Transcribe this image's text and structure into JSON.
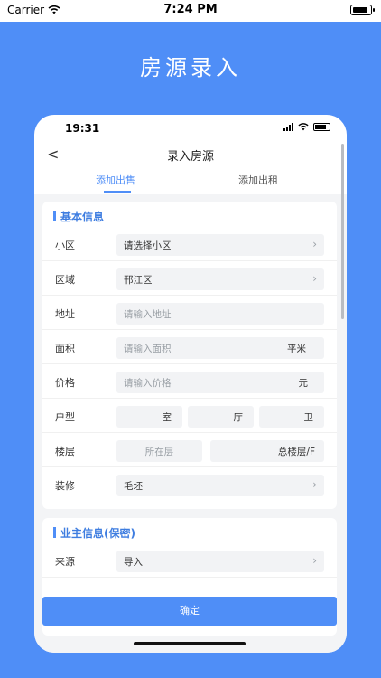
{
  "outer_status": {
    "carrier": "Carrier",
    "time": "7:24 PM"
  },
  "hero_title": "房源录入",
  "inner_status": {
    "time": "19:31"
  },
  "nav": {
    "back": "<",
    "title": "录入房源"
  },
  "tabs": [
    {
      "label": "添加出售",
      "active": true
    },
    {
      "label": "添加出租",
      "active": false
    }
  ],
  "basic_info": {
    "title": "基本信息",
    "community": {
      "label": "小区",
      "value": "请选择小区"
    },
    "district": {
      "label": "区域",
      "value": "邗江区"
    },
    "address": {
      "label": "地址",
      "placeholder": "请输入地址"
    },
    "area": {
      "label": "面积",
      "placeholder": "请输入面积",
      "unit": "平米"
    },
    "price": {
      "label": "价格",
      "placeholder": "请输入价格",
      "unit": "元"
    },
    "layout": {
      "label": "户型",
      "room": "室",
      "hall": "厅",
      "bath": "卫"
    },
    "floor": {
      "label": "楼层",
      "floor_placeholder": "所在层",
      "total": "总楼层/F"
    },
    "decoration": {
      "label": "装修",
      "value": "毛坯"
    }
  },
  "owner_info": {
    "title": "业主信息(保密)",
    "source": {
      "label": "来源",
      "value": "导入"
    }
  },
  "confirm_label": "确定",
  "colors": {
    "primary": "#4f8ef7",
    "background": "#f3f4f6"
  }
}
